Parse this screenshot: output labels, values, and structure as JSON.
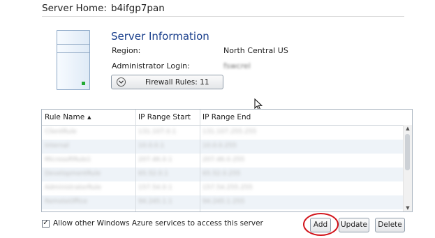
{
  "header": {
    "server_home_label": "Server Home:",
    "server_name": "b4ifgp7pan"
  },
  "info": {
    "title": "Server Information",
    "region_label": "Region:",
    "region_value": "North Central US",
    "admin_label": "Administrator Login:",
    "admin_value": "fswcrel",
    "firewall_button": "Firewall Rules: 11"
  },
  "grid": {
    "columns": [
      "Rule Name",
      "IP Range Start",
      "IP Range End"
    ],
    "sort_indicator": "▲",
    "rows": [
      [
        "ClientRule",
        "131.107.0.1",
        "131.107.255.255"
      ],
      [
        "Internal",
        "10.0.0.1",
        "10.0.0.255"
      ],
      [
        "MicrosoftRule1",
        "207.46.0.1",
        "207.46.0.255"
      ],
      [
        "DevelopmentRule",
        "65.52.0.1",
        "65.52.0.255"
      ],
      [
        "AdministratorRule",
        "157.54.0.1",
        "157.54.255.255"
      ],
      [
        "RemoteOffice",
        "94.245.1.1",
        "94.245.1.255"
      ]
    ]
  },
  "footer": {
    "allow_checkbox_label": "Allow other Windows Azure services to access this server",
    "allow_checked": true,
    "check_mark": "✓",
    "add_label": "Add",
    "update_label": "Update",
    "delete_label": "Delete"
  },
  "icons": {
    "server": "server-icon",
    "chevron": "chevron-down-icon",
    "cursor": "mouse-pointer-icon"
  },
  "colors": {
    "title": "#1a3f8c",
    "highlight_ring": "#d2141b",
    "row_alt": "#eef3f8"
  }
}
